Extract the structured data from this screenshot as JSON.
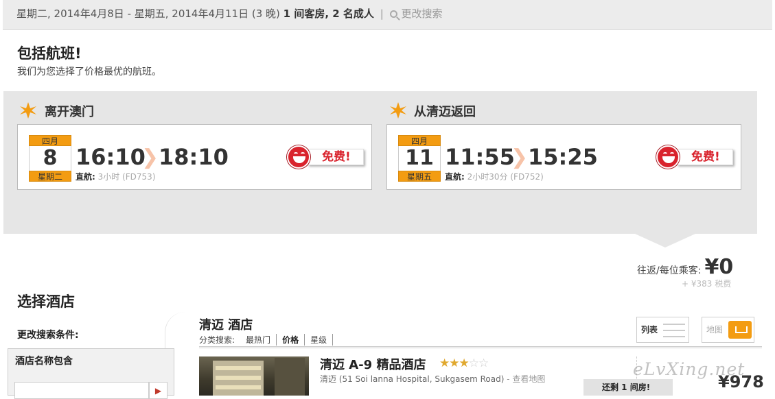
{
  "search_bar": {
    "dates": "星期二, 2014年4月8日 - 星期五, 2014年4月11日 (3 晚)",
    "rooms_guests": "1 间客房, 2 名成人",
    "separator": "|",
    "change_search": "更改搜索"
  },
  "package": {
    "title": "包括航班!",
    "subtitle": "我们为您选择了价格最优的航班。"
  },
  "outbound": {
    "heading": "离开澳门",
    "month": "四月",
    "day": "8",
    "weekday": "星期二",
    "depart_time": "16:10",
    "arrive_time": "18:10",
    "direct_label": "直航:",
    "details": "3小时 (FD753)",
    "free_label": "免费!"
  },
  "return": {
    "heading": "从清迈返回",
    "month": "四月",
    "day": "11",
    "weekday": "星期五",
    "depart_time": "11:55",
    "arrive_time": "15:25",
    "direct_label": "直航:",
    "details": "2小时30分 (FD752)",
    "free_label": "免费!"
  },
  "fare": {
    "label": "往返/每位乘客:",
    "amount": "¥0",
    "tax": "+ ¥383 税费"
  },
  "hotels": {
    "title": "选择酒店",
    "sidebar": {
      "heading": "更改搜索条件:",
      "filter_title": "酒店名称包含",
      "go_symbol": "▶"
    },
    "city_title": "清迈 酒店",
    "sort": {
      "label": "分类搜索:",
      "options": [
        "最热门",
        "价格",
        "星级"
      ]
    },
    "view_list": "列表",
    "view_map": "地图",
    "items": [
      {
        "name": "清迈 A-9 精品酒店",
        "stars": 2.5,
        "address": "清迈 (51 Soi lanna Hospital, Sukgasem Road)",
        "map_link": "- 查看地图",
        "rooms_left": "还剩 1 间房!",
        "price": "¥978"
      }
    ]
  },
  "watermark": "eLvXing.net",
  "colors": {
    "accent_orange": "#f39c12",
    "free_red": "#d9232d",
    "panel_grey": "#e6e6e6"
  }
}
